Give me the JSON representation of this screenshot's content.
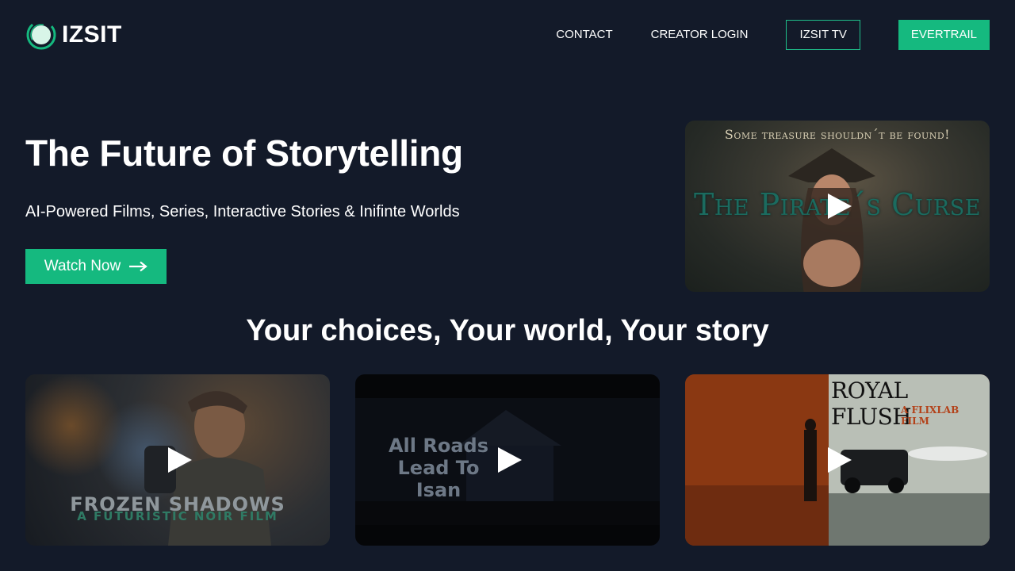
{
  "header": {
    "logo_text": "IZSIT",
    "nav": {
      "contact": "CONTACT",
      "creator_login": "CREATOR LOGIN",
      "izsit_tv": "IZSIT TV",
      "evertrail": "EVERTRAIL"
    }
  },
  "hero": {
    "title": "The Future of Storytelling",
    "subtitle": "AI-Powered Films, Series, Interactive Stories & Inifinte Worlds",
    "watch_button": "Watch Now",
    "featured": {
      "tagline": "Some treasure shouldn´t be found!",
      "title": "The Pirate´s Curse"
    }
  },
  "section": {
    "title": "Your choices, Your world, Your story"
  },
  "cards": [
    {
      "title": "FROZEN SHADOWS",
      "subtitle": "A FUTURISTIC NOIR FILM"
    },
    {
      "title_line1": "All Roads",
      "title_line2": "Lead To Isan"
    },
    {
      "title": "ROYAL FLUSH",
      "subtitle": "A FLIXLAB FILM"
    }
  ],
  "colors": {
    "background": "#131a29",
    "accent": "#15b97f"
  }
}
